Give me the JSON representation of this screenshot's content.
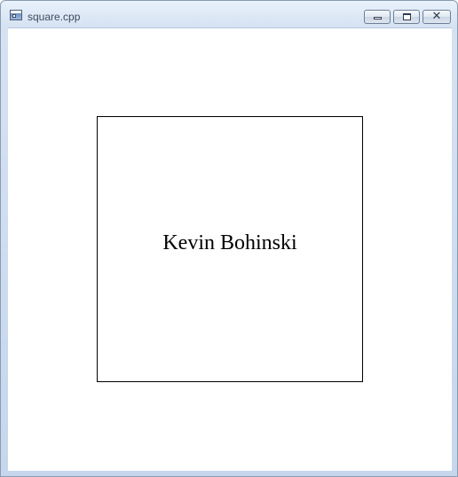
{
  "window": {
    "title": "square.cpp",
    "icon": "application-window-icon",
    "controls": {
      "minimize": "minimize-icon",
      "maximize": "maximize-icon",
      "close": "close-icon",
      "close_glyph": "✕"
    }
  },
  "canvas": {
    "square_text": "Kevin Bohinski",
    "border_color": "#000000",
    "background_color": "#ffffff"
  }
}
